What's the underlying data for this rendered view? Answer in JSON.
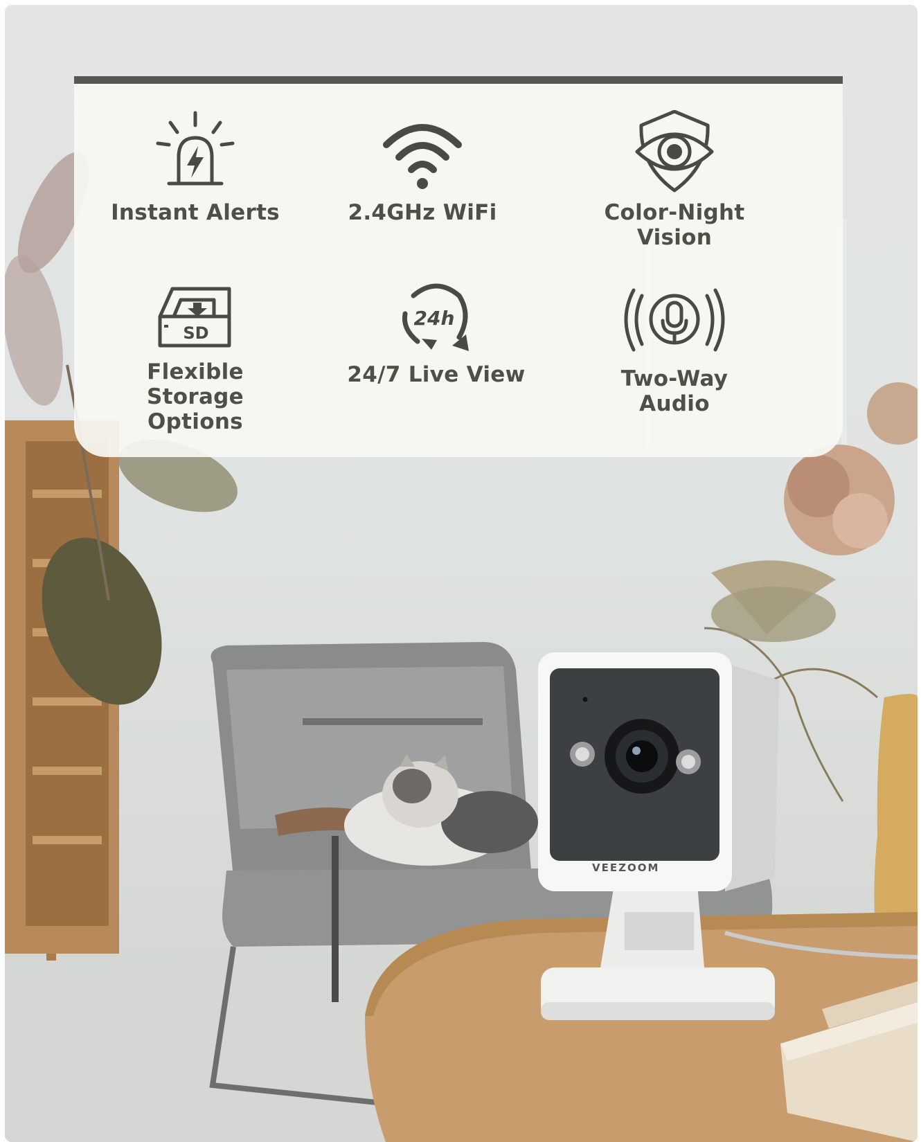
{
  "features": [
    {
      "icon": "alarm-icon",
      "label": "Instant Alerts"
    },
    {
      "icon": "wifi-icon",
      "label": "2.4GHz WiFi"
    },
    {
      "icon": "night-vision-eye-icon",
      "label": "Color-Night Vision"
    },
    {
      "icon": "sd-card-icon",
      "label": "Flexible Storage Options"
    },
    {
      "icon": "live-view-24h-icon",
      "label": "24/7 Live View"
    },
    {
      "icon": "microphone-audio-icon",
      "label": "Two-Way Audio"
    }
  ],
  "icon_texts": {
    "sd": "SD",
    "hours": "24h"
  },
  "product": {
    "brand": "VEEZOOM"
  },
  "colors": {
    "panel_bar": "#57574f",
    "icon": "#4a4a44",
    "label": "#4f4f48"
  }
}
